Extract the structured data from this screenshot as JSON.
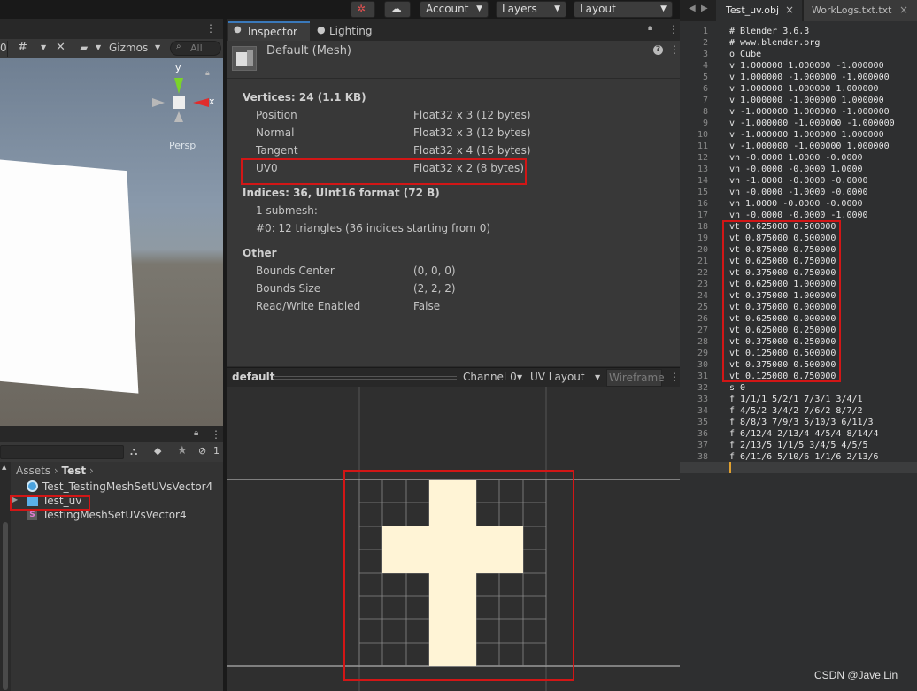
{
  "toolbar": {
    "account_label": "Account",
    "layers_label": "Layers",
    "layout_label": "Layout"
  },
  "scene": {
    "zero_label": "0",
    "gizmos_label": "Gizmos",
    "search_placeholder": "All",
    "persp_label": "Persp",
    "axis_y": "y",
    "axis_x": "x"
  },
  "project": {
    "breadcrumb_root": "Assets",
    "breadcrumb_child": "Test",
    "hidden_count": "1",
    "items": [
      {
        "label": "Test_TestingMeshSetUVsVector4"
      },
      {
        "label": "Test_uv"
      },
      {
        "label": "TestingMeshSetUVsVector4"
      }
    ]
  },
  "inspector": {
    "tabs": [
      "Inspector",
      "Lighting"
    ],
    "title": "Default (Mesh)",
    "vertices_header": "Vertices: 24 (1.1 KB)",
    "attributes": [
      {
        "name": "Position",
        "format": "Float32 x 3 (12 bytes)"
      },
      {
        "name": "Normal",
        "format": "Float32 x 3 (12 bytes)"
      },
      {
        "name": "Tangent",
        "format": "Float32 x 4 (16 bytes)"
      },
      {
        "name": "UV0",
        "format": "Float32 x 2 (8 bytes)"
      }
    ],
    "indices_header": "Indices: 36, UInt16 format (72 B)",
    "submesh_count": "1 submesh:",
    "submesh_detail": "#0: 12 triangles (36 indices starting from 0)",
    "other_header": "Other",
    "other": [
      {
        "name": "Bounds Center",
        "value": "(0, 0, 0)"
      },
      {
        "name": "Bounds Size",
        "value": "(2, 2, 2)"
      },
      {
        "name": "Read/Write Enabled",
        "value": "False"
      }
    ]
  },
  "preview": {
    "title": "default",
    "channel": "Channel 0",
    "mode": "UV Layout",
    "wireframe": "Wireframe"
  },
  "editor": {
    "tabs": [
      "Test_uv.obj",
      "WorkLogs.txt.txt"
    ],
    "lines": [
      "# Blender 3.6.3",
      "# www.blender.org",
      "o Cube",
      "v 1.000000 1.000000 -1.000000",
      "v 1.000000 -1.000000 -1.000000",
      "v 1.000000 1.000000 1.000000",
      "v 1.000000 -1.000000 1.000000",
      "v -1.000000 1.000000 -1.000000",
      "v -1.000000 -1.000000 -1.000000",
      "v -1.000000 1.000000 1.000000",
      "v -1.000000 -1.000000 1.000000",
      "vn -0.0000 1.0000 -0.0000",
      "vn -0.0000 -0.0000 1.0000",
      "vn -1.0000 -0.0000 -0.0000",
      "vn -0.0000 -1.0000 -0.0000",
      "vn 1.0000 -0.0000 -0.0000",
      "vn -0.0000 -0.0000 -1.0000",
      "vt 0.625000 0.500000",
      "vt 0.875000 0.500000",
      "vt 0.875000 0.750000",
      "vt 0.625000 0.750000",
      "vt 0.375000 0.750000",
      "vt 0.625000 1.000000",
      "vt 0.375000 1.000000",
      "vt 0.375000 0.000000",
      "vt 0.625000 0.000000",
      "vt 0.625000 0.250000",
      "vt 0.375000 0.250000",
      "vt 0.125000 0.500000",
      "vt 0.375000 0.500000",
      "vt 0.125000 0.750000",
      "s 0",
      "f 1/1/1 5/2/1 7/3/1 3/4/1",
      "f 4/5/2 3/4/2 7/6/2 8/7/2",
      "f 8/8/3 7/9/3 5/10/3 6/11/3",
      "f 6/12/4 2/13/4 4/5/4 8/14/4",
      "f 2/13/5 1/1/5 3/4/5 4/5/5",
      "f 6/11/6 5/10/6 1/1/6 2/13/6",
      ""
    ]
  },
  "watermark": "CSDN @Jave.Lin",
  "colors": {
    "highlight": "#d21616",
    "uv_fill": "#fff4d6"
  }
}
